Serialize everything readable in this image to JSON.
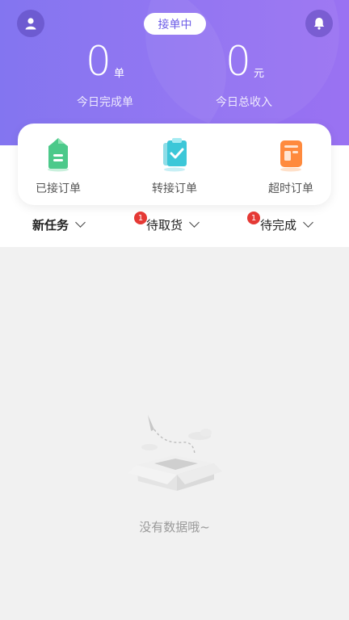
{
  "header": {
    "status": "接单中",
    "stats": [
      {
        "value": "0",
        "unit": "单",
        "label": "今日完成单"
      },
      {
        "value": "0",
        "unit": "元",
        "label": "今日总收入"
      }
    ]
  },
  "quick_actions": [
    {
      "label": "已接订单",
      "icon": "received-order-icon",
      "color": "#4cc98a"
    },
    {
      "label": "转接订单",
      "icon": "transfer-order-icon",
      "color": "#3cc7d8"
    },
    {
      "label": "超时订单",
      "icon": "timeout-order-icon",
      "color": "#ff8a3d"
    }
  ],
  "tabs": [
    {
      "label": "新任务",
      "badge": ""
    },
    {
      "label": "待取货",
      "badge": "1"
    },
    {
      "label": "待完成",
      "badge": "1"
    }
  ],
  "empty": {
    "text": "没有数据哦~"
  },
  "colors": {
    "accent": "#7c6df0",
    "badge": "#e53935"
  }
}
